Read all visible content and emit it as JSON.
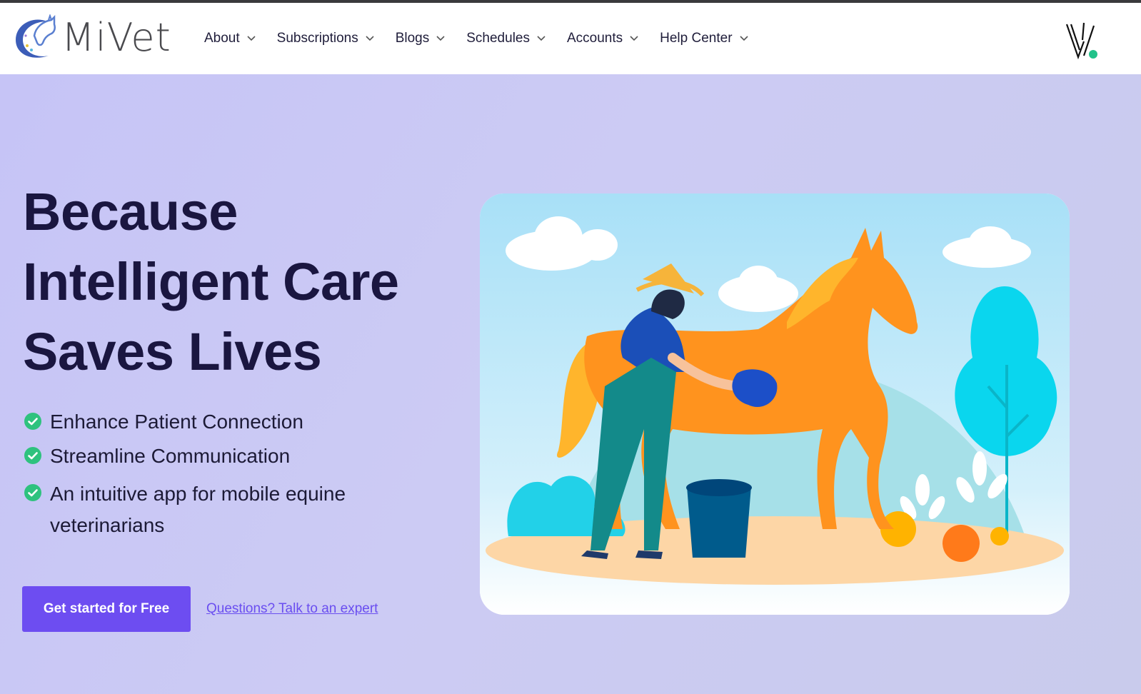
{
  "brand": {
    "name": "MiVet",
    "logo_icon": "horse-crescent-logo-icon",
    "right_mark_icon": "v-mark-icon"
  },
  "nav": {
    "items": [
      {
        "label": "About",
        "icon": "chevron-down-icon"
      },
      {
        "label": "Subscriptions",
        "icon": "chevron-down-icon"
      },
      {
        "label": "Blogs",
        "icon": "chevron-down-icon"
      },
      {
        "label": "Schedules",
        "icon": "chevron-down-icon"
      },
      {
        "label": "Accounts",
        "icon": "chevron-down-icon"
      },
      {
        "label": "Help Center",
        "icon": "chevron-down-icon"
      }
    ]
  },
  "hero": {
    "headline_lines": [
      "Because",
      "Intelligent Care",
      "Saves Lives"
    ],
    "features": [
      {
        "text": "Enhance Patient Connection",
        "icon": "check-circle-icon"
      },
      {
        "text": "Streamline Communication",
        "icon": "check-circle-icon"
      },
      {
        "text": "An intuitive app for mobile equine veterinarians",
        "icon": "check-circle-icon"
      }
    ],
    "cta_label": "Get started for Free",
    "expert_link": "Questions? Talk to an expert",
    "illustration": "person-grooming-horse-illustration"
  },
  "colors": {
    "accent": "#6d4df1",
    "headline": "#1a1640",
    "hero_bg": "#cac9f2",
    "check": "#2ec27e"
  }
}
